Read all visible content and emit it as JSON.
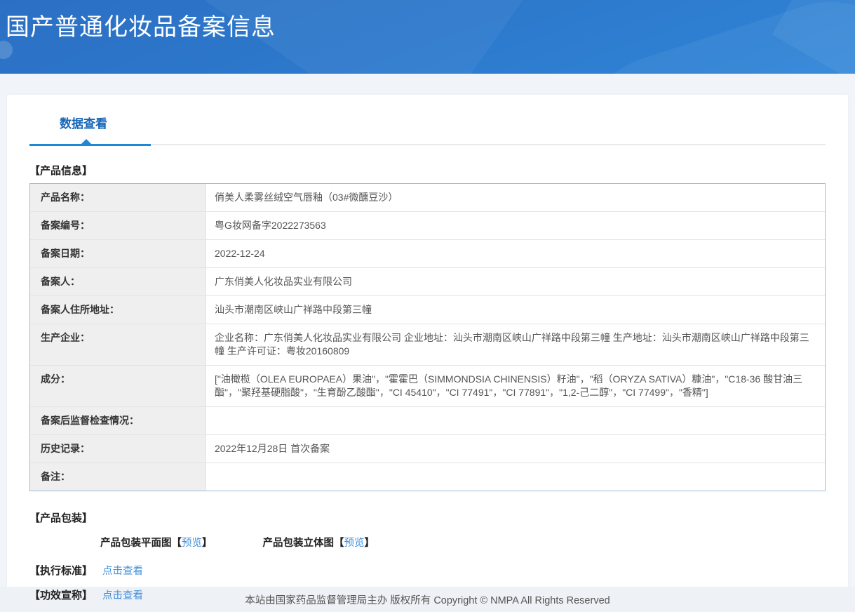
{
  "header": {
    "title": "国产普通化妆品备案信息"
  },
  "tabs": {
    "data_view": "数据查看"
  },
  "product_info": {
    "section_title": "【产品信息】",
    "rows": [
      {
        "label": "产品名称：",
        "value": "俏美人柔雾丝绒空气唇釉（03#微醺豆沙）"
      },
      {
        "label": "备案编号：",
        "value": "粤G妆网备字2022273563"
      },
      {
        "label": "备案日期：",
        "value": "2022-12-24"
      },
      {
        "label": "备案人：",
        "value": "广东俏美人化妆品实业有限公司"
      },
      {
        "label": "备案人住所地址：",
        "value": "汕头市潮南区峡山广祥路中段第三幢"
      },
      {
        "label": "生产企业：",
        "value": "企业名称：广东俏美人化妆品实业有限公司 企业地址：汕头市潮南区峡山广祥路中段第三幢 生产地址：汕头市潮南区峡山广祥路中段第三幢 生产许可证：粤妆20160809"
      },
      {
        "label": "成分：",
        "value": "[\"油橄榄（OLEA EUROPAEA）果油\"，\"霍霍巴（SIMMONDSIA CHINENSIS）籽油\"，\"稻（ORYZA SATIVA）糠油\"，\"C18-36 酸甘油三酯\"，\"聚羟基硬脂酸\"，\"生育酚乙酸酯\"，\"CI 45410\"，\"CI 77491\"，\"CI 77891\"，\"1,2-己二醇\"，\"CI 77499\"，\"香精\"]"
      },
      {
        "label": "备案后监督检查情况：",
        "value": ""
      },
      {
        "label": "历史记录：",
        "value": "2022年12月28日 首次备案"
      },
      {
        "label": "备注：",
        "value": ""
      }
    ]
  },
  "packaging": {
    "section_title": "【产品包装】",
    "items": [
      {
        "label": "产品包装平面图",
        "bracket_open": "【",
        "link": "预览",
        "bracket_close": "】"
      },
      {
        "label": "产品包装立体图 ",
        "bracket_open": "【",
        "link": "预览",
        "bracket_close": "】"
      }
    ]
  },
  "standards": {
    "section_title": "【执行标准】",
    "link": "点击查看"
  },
  "efficacy": {
    "section_title": "【功效宣称】",
    "link": "点击查看"
  },
  "footer": {
    "text": "本站由国家药品监督管理局主办 版权所有 Copyright © NMPA All Rights Reserved"
  },
  "colors": {
    "header_gradient_start": "#2b6fc4",
    "header_gradient_end": "#2f85d7",
    "tab_accent": "#1e88d8",
    "tab_text": "#1766b8",
    "link": "#4090dd",
    "table_border": "#9fbbdd",
    "label_cell_bg": "#efefef",
    "footer_bg": "#eef1f6"
  }
}
